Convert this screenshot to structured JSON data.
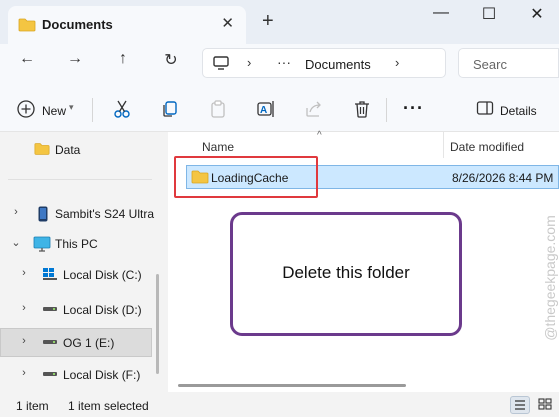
{
  "window": {
    "tab_title": "Documents",
    "new_tab_label": "+",
    "controls": {
      "minimize": "—",
      "maximize": "☐",
      "close": "✕"
    }
  },
  "nav": {
    "back": "←",
    "forward": "→",
    "up": "↑",
    "refresh": "↻",
    "breadcrumb_more": "···",
    "breadcrumb_current": "Documents",
    "search_placeholder": "Searc"
  },
  "toolbar": {
    "new_label": "New",
    "more_label": "···",
    "details_label": "Details",
    "icons": [
      "add-icon",
      "cut-icon",
      "copy-icon",
      "paste-icon",
      "rename-icon",
      "share-icon",
      "delete-icon",
      "details-pane-icon"
    ]
  },
  "sidebar": {
    "items": [
      {
        "label": "Data",
        "icon": "folder-icon",
        "expandable": false
      },
      {
        "label": "Sambit's S24 Ultra",
        "icon": "phone-icon",
        "expandable": true,
        "expanded": false
      },
      {
        "label": "This PC",
        "icon": "monitor-icon",
        "expandable": true,
        "expanded": true
      },
      {
        "label": "Local Disk (C:)",
        "icon": "windows-drive-icon",
        "expandable": true,
        "expanded": false
      },
      {
        "label": "Local Disk (D:)",
        "icon": "drive-icon",
        "expandable": true,
        "expanded": false
      },
      {
        "label": "OG 1 (E:)",
        "icon": "drive-icon",
        "expandable": true,
        "expanded": false,
        "selected": true
      },
      {
        "label": "Local Disk (F:)",
        "icon": "drive-icon",
        "expandable": true,
        "expanded": false
      }
    ]
  },
  "content": {
    "columns": {
      "name": "Name",
      "date_modified": "Date modified"
    },
    "rows": [
      {
        "name": "LoadingCache",
        "date_modified": "8/26/2026 8:44 PM",
        "icon": "folder-icon",
        "selected": true
      }
    ],
    "annotation": "Delete this folder",
    "watermark": "@thegeekpage.com"
  },
  "status": {
    "item_count": "1 item",
    "selected_count": "1 item selected"
  },
  "colors": {
    "accent": "#0067c0",
    "selection": "#cce8ff",
    "highlight_box": "#e0393e",
    "callout_border": "#6b3a8c",
    "folder": "#f4c542"
  }
}
